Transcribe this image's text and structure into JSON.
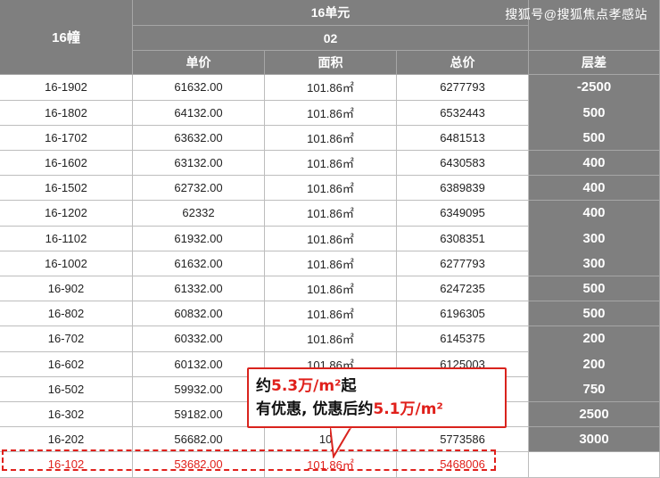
{
  "header": {
    "building": "16幢",
    "unit": "16单元",
    "room": "02",
    "columns": [
      "单价",
      "面积",
      "总价"
    ],
    "diff_label": "层差",
    "watermark": "搜狐号@搜狐焦点孝感站"
  },
  "rows": [
    {
      "room": "16-1902",
      "unit_price": "61632.00",
      "area": "101.86㎡",
      "total": "6277793",
      "diff": "-2500"
    },
    {
      "room": "16-1802",
      "unit_price": "64132.00",
      "area": "101.86㎡",
      "total": "6532443",
      "diff": "500"
    },
    {
      "room": "16-1702",
      "unit_price": "63632.00",
      "area": "101.86㎡",
      "total": "6481513",
      "diff": "500"
    },
    {
      "room": "16-1602",
      "unit_price": "63132.00",
      "area": "101.86㎡",
      "total": "6430583",
      "diff": "400"
    },
    {
      "room": "16-1502",
      "unit_price": "62732.00",
      "area": "101.86㎡",
      "total": "6389839",
      "diff": "400"
    },
    {
      "room": "16-1202",
      "unit_price": "62332",
      "area": "101.86㎡",
      "total": "6349095",
      "diff": "400"
    },
    {
      "room": "16-1102",
      "unit_price": "61932.00",
      "area": "101.86㎡",
      "total": "6308351",
      "diff": "300"
    },
    {
      "room": "16-1002",
      "unit_price": "61632.00",
      "area": "101.86㎡",
      "total": "6277793",
      "diff": "300"
    },
    {
      "room": "16-902",
      "unit_price": "61332.00",
      "area": "101.86㎡",
      "total": "6247235",
      "diff": "500"
    },
    {
      "room": "16-802",
      "unit_price": "60832.00",
      "area": "101.86㎡",
      "total": "6196305",
      "diff": "500"
    },
    {
      "room": "16-702",
      "unit_price": "60332.00",
      "area": "101.86㎡",
      "total": "6145375",
      "diff": "200"
    },
    {
      "room": "16-602",
      "unit_price": "60132.00",
      "area": "101.86㎡",
      "total": "6125003",
      "diff": "200"
    },
    {
      "room": "16-502",
      "unit_price": "59932.00",
      "area": "",
      "total": "",
      "diff": "750"
    },
    {
      "room": "16-302",
      "unit_price": "59182.00",
      "area": "",
      "total": "",
      "diff": "2500"
    },
    {
      "room": "16-202",
      "unit_price": "56682.00",
      "area": "101.",
      "total": "5773586",
      "diff": "3000"
    },
    {
      "room": "16-102",
      "unit_price": "53682.00",
      "area": "101.86㎡",
      "total": "5468006",
      "diff": ""
    }
  ],
  "callout": {
    "line1_prefix": "约",
    "line1_value": "5.3万/m²",
    "line1_suffix": "起",
    "line2_prefix": "有优惠, 优惠后约",
    "line2_value": "5.1万/m²"
  },
  "colors": {
    "header_bg": "#7f7f7f",
    "accent_red": "#e0201b"
  }
}
